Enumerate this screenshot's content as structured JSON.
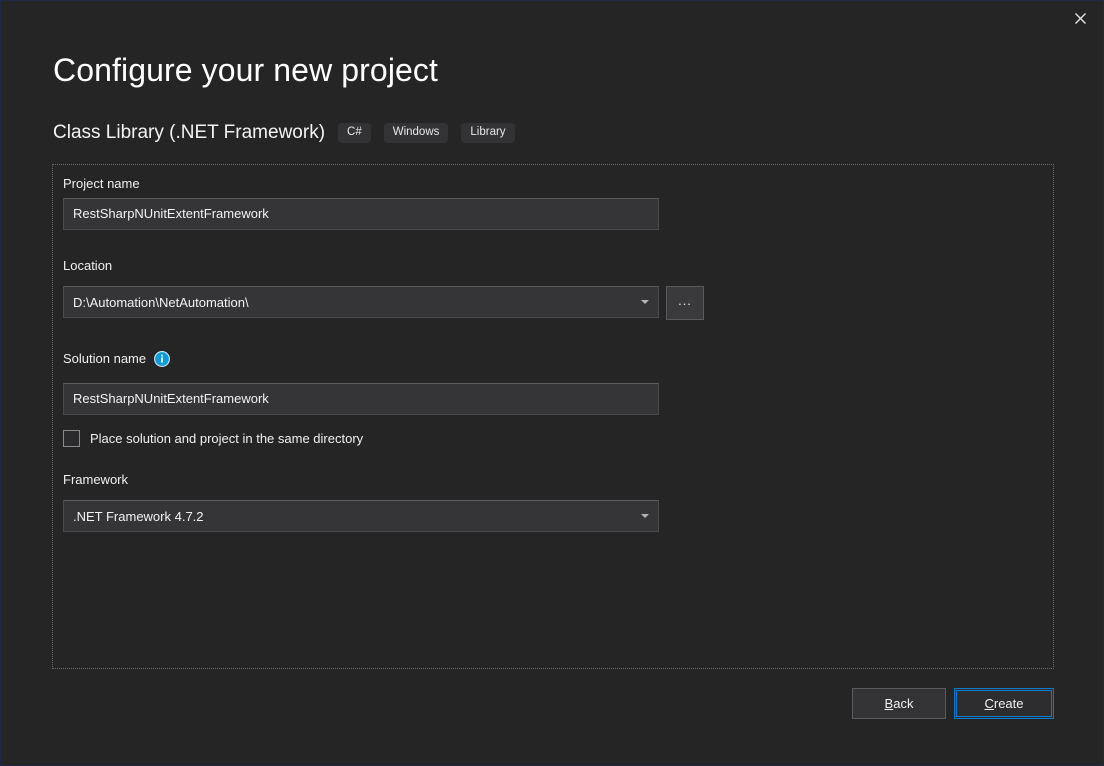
{
  "window": {
    "close_icon": "close-icon"
  },
  "header": {
    "title": "Configure your new project",
    "template_name": "Class Library (.NET Framework)",
    "tags": [
      "C#",
      "Windows",
      "Library"
    ]
  },
  "form": {
    "project_name": {
      "label": "Project name",
      "value": "RestSharpNUnitExtentFramework"
    },
    "location": {
      "label": "Location",
      "value": "D:\\Automation\\NetAutomation\\",
      "browse_label": "..."
    },
    "solution_name": {
      "label": "Solution name",
      "info_icon": "info-icon",
      "value": "RestSharpNUnitExtentFramework"
    },
    "same_directory": {
      "label": "Place solution and project in the same directory",
      "checked": false
    },
    "framework": {
      "label": "Framework",
      "value": ".NET Framework 4.7.2"
    }
  },
  "footer": {
    "back": {
      "prefix": "",
      "accel": "B",
      "suffix": "ack"
    },
    "create": {
      "prefix": "",
      "accel": "C",
      "suffix": "reate"
    }
  },
  "colors": {
    "background": "#252526",
    "input_background": "#353538",
    "accent_blue": "#0a7bcd",
    "info_blue": "#0e9bd8",
    "text": "#f0f0f0"
  }
}
